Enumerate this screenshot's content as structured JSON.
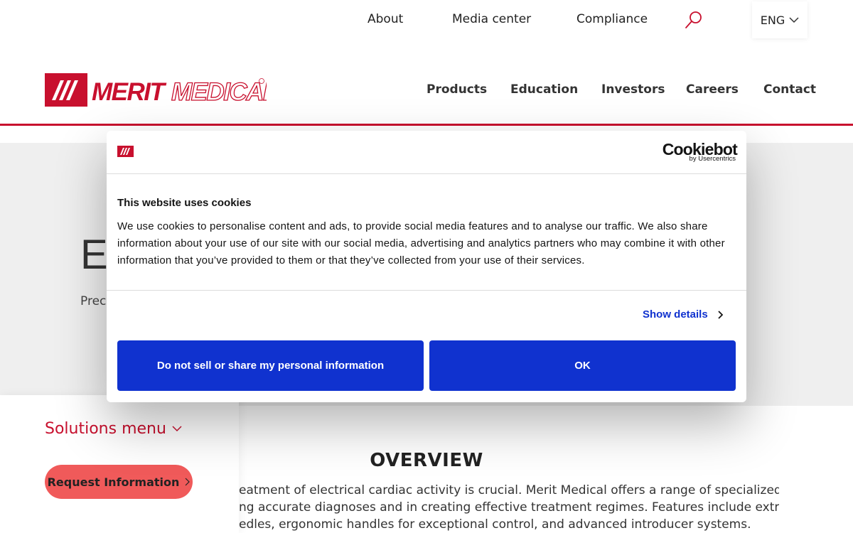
{
  "top_links": {
    "about": "About",
    "media_center": "Media center",
    "compliance": "Compliance",
    "language": "ENG"
  },
  "brand": {
    "name": "MERIT MEDICAL",
    "accent_color": "#c8102e"
  },
  "main_nav": {
    "products": "Products",
    "education": "Education",
    "investors": "Investors",
    "careers": "Careers",
    "contact": "Contact"
  },
  "hero": {
    "title_fragment": "E",
    "subtitle_fragment": "Preci"
  },
  "sidebar": {
    "solutions_menu": "Solutions menu",
    "request_button": "Request Information"
  },
  "overview": {
    "title": "OVERVIEW",
    "lines": [
      "eatment of electrical cardiac activity is crucial. Merit Medical offers a range of specialized tools",
      "ng accurate diagnoses and in creating effective treatment regimes. Features include extra stiff",
      "edles, ergonomic handles for exceptional control, and advanced introducer systems."
    ]
  },
  "cookie_banner": {
    "provider": "Cookiebot",
    "provider_sub": "by Usercentrics",
    "title": "This website uses cookies",
    "body": "We use cookies to personalise content and ads, to provide social media features and to analyse our traffic. We also share information about your use of our site with our social media, advertising and analytics partners who may combine it with other information that you’ve provided to them or that they’ve collected from your use of their services.",
    "show_details": "Show details",
    "do_not_sell": "Do not sell or share my personal information",
    "ok": "OK",
    "button_color": "#1032cf"
  }
}
